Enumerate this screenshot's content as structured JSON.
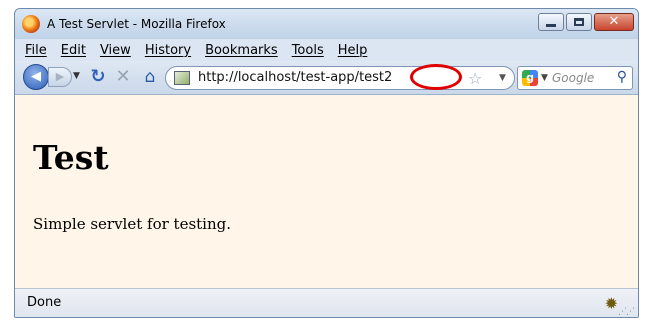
{
  "window": {
    "title": "A Test Servlet - Mozilla Firefox",
    "close_glyph": "✕"
  },
  "menu": {
    "items": [
      "File",
      "Edit",
      "View",
      "History",
      "Bookmarks",
      "Tools",
      "Help"
    ]
  },
  "navigation": {
    "url": "http://localhost/test-app/test2",
    "search_placeholder": "Google",
    "search_engine_letter": "g",
    "icons": [
      "back-arrow-icon",
      "forward-arrow-icon",
      "reload-icon",
      "stop-icon",
      "home-icon",
      "site-favicon-icon",
      "bookmark-star-icon",
      "google-icon",
      "magnifier-icon"
    ]
  },
  "page": {
    "heading": "Test",
    "paragraph": "Simple servlet for testing."
  },
  "status": {
    "text": "Done"
  },
  "colors": {
    "content_background": "#fff6e9",
    "highlight_ring": "#e00000",
    "title_bar": "#cfdcec"
  }
}
